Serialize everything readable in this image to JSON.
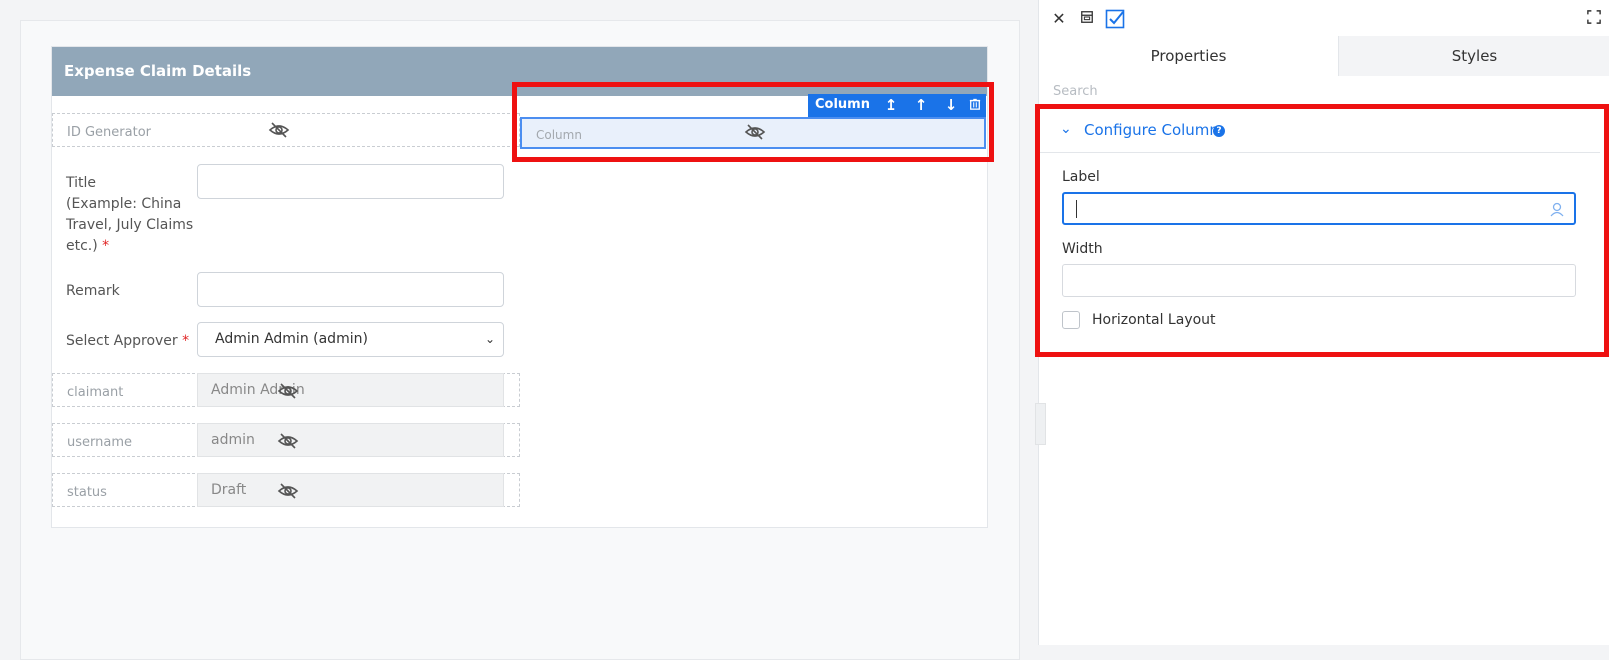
{
  "form": {
    "header_title": "Expense Claim Details",
    "fields": {
      "id_generator": "ID Generator",
      "title_label_line1": "Title",
      "title_label_line2": "(Example: China",
      "title_label_line3": "Travel, July Claims",
      "title_label_line4": "etc.)",
      "remark_label": "Remark",
      "approver_label": "Select Approver",
      "approver_value": "Admin Admin (admin)",
      "claimant_label": "claimant",
      "claimant_value": "Admin Admin",
      "username_label": "username",
      "username_value": "admin",
      "status_label": "status",
      "status_value": "Draft",
      "required_mark": "*"
    }
  },
  "column_element": {
    "toolbar_label": "Column",
    "placeholder_label": "Column"
  },
  "right_panel": {
    "tabs": [
      "Properties",
      "Styles"
    ],
    "search_placeholder": "Search",
    "section_title": "Configure Column",
    "help_glyph": "?",
    "label_field": "Label",
    "width_field": "Width",
    "horizontal_layout": "Horizontal Layout",
    "label_value": "",
    "width_value": ""
  },
  "colors": {
    "accent": "#1a73e8",
    "highlight_border": "#ee1111",
    "header_bg": "#91a7b9"
  },
  "icons": {
    "close": "close-icon",
    "preview": "preview-icon",
    "check": "check-icon",
    "fullscreen": "fullscreen-icon",
    "hidden": "eye-slash-icon"
  }
}
